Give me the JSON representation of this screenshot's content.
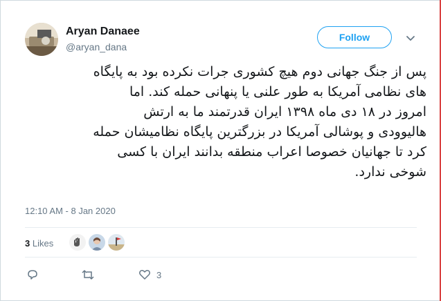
{
  "user": {
    "display_name": "Aryan Danaee",
    "handle": "@aryan_dana"
  },
  "follow_label": "Follow",
  "tweet": {
    "lines": [
      "پس از جنگ جهانی دوم هیچ کشوری جرات نکرده بود به پایگاه",
      "های نظامی آمریکا به طور علنی یا پنهانی حمله کند. اما",
      "امروز در ۱۸ دی ماه ۱۳۹۸ ایران قدرتمند ما به ارتش",
      "هالیوودی و پوشالی آمریکا در بزرگترین پایگاه نظامیشان حمله",
      "کرد تا جهانیان خصوصا اعراب منطقه بدانند ایران با کسی",
      "شوخی ندارد."
    ],
    "timestamp": "12:10 AM - 8 Jan 2020"
  },
  "stats": {
    "likes_count": "3",
    "likes_label": "Likes"
  },
  "actions": {
    "reply_icon": "reply-icon",
    "retweet_icon": "retweet-icon",
    "like_icon": "heart-icon",
    "like_count": "3"
  },
  "colors": {
    "accent": "#1da1f2",
    "secondary_text": "#657786",
    "divider": "#e6ecf0"
  }
}
